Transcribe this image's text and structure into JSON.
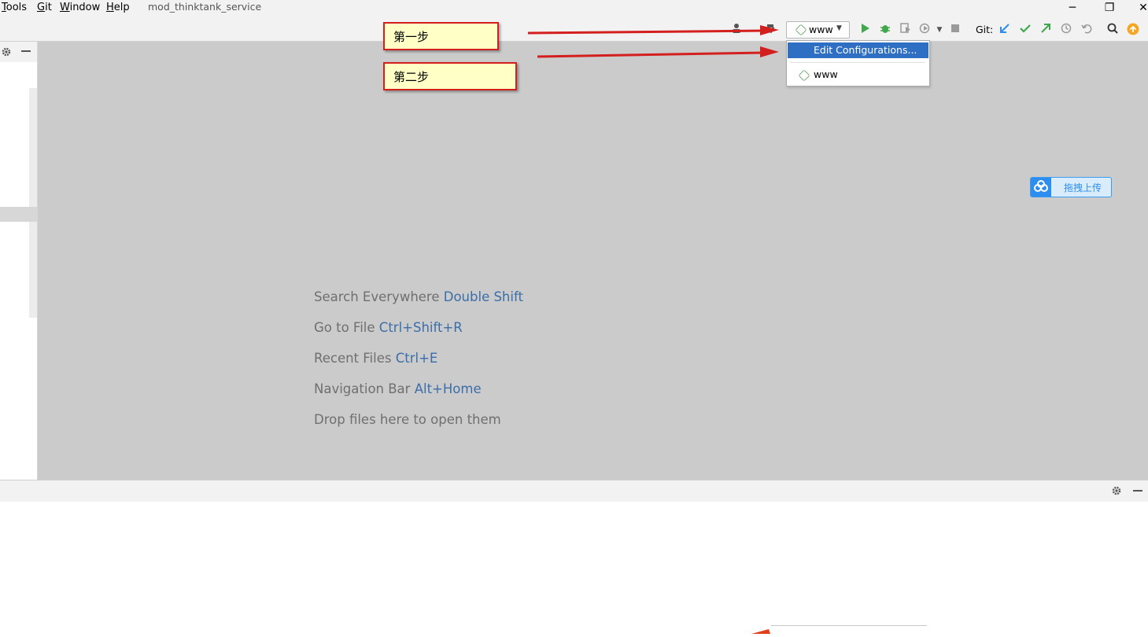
{
  "menu": {
    "items": [
      {
        "label": "Tools",
        "mnemonic": "T",
        "rest": "ools"
      },
      {
        "label": "Git",
        "mnemonic": "G",
        "rest": "it"
      },
      {
        "label": "Window",
        "mnemonic": "W",
        "rest": "indow"
      },
      {
        "label": "Help",
        "mnemonic": "H",
        "rest": "elp"
      }
    ],
    "project_title": "mod_thinktank_service"
  },
  "window_controls": {
    "minimize": "─",
    "restore": "❐",
    "close": "✕"
  },
  "toolbar": {
    "run_config_label": "www",
    "git_label": "Git:",
    "icons": [
      "user-icon",
      "hammer-icon",
      "run-icon",
      "debug-icon",
      "coverage-icon",
      "profile-icon",
      "stop-icon",
      "git-update-icon",
      "git-commit-icon",
      "git-push-icon",
      "history-icon",
      "rollback-icon",
      "search-icon",
      "update-icon"
    ]
  },
  "dropdown": {
    "edit_label": "Edit Configurations...",
    "item_label": "www"
  },
  "annotations": {
    "step1": "第一步",
    "step2": "第二步"
  },
  "upload": {
    "label": "拖拽上传"
  },
  "editor_hints": [
    {
      "text": "Search Everywhere ",
      "key": "Double Shift"
    },
    {
      "text": "Go to File ",
      "key": "Ctrl+Shift+R"
    },
    {
      "text": "Recent Files ",
      "key": "Ctrl+E"
    },
    {
      "text": "Navigation Bar ",
      "key": "Alt+Home"
    },
    {
      "text": "Drop files here to open them",
      "key": ""
    }
  ],
  "colors": {
    "annotation_red": "#d41f1f",
    "annotation_fill": "#ffffc6",
    "selection_blue": "#2e6fc3",
    "hint_key_blue": "#3b6ea8",
    "editor_bg": "#cbcbcb"
  }
}
